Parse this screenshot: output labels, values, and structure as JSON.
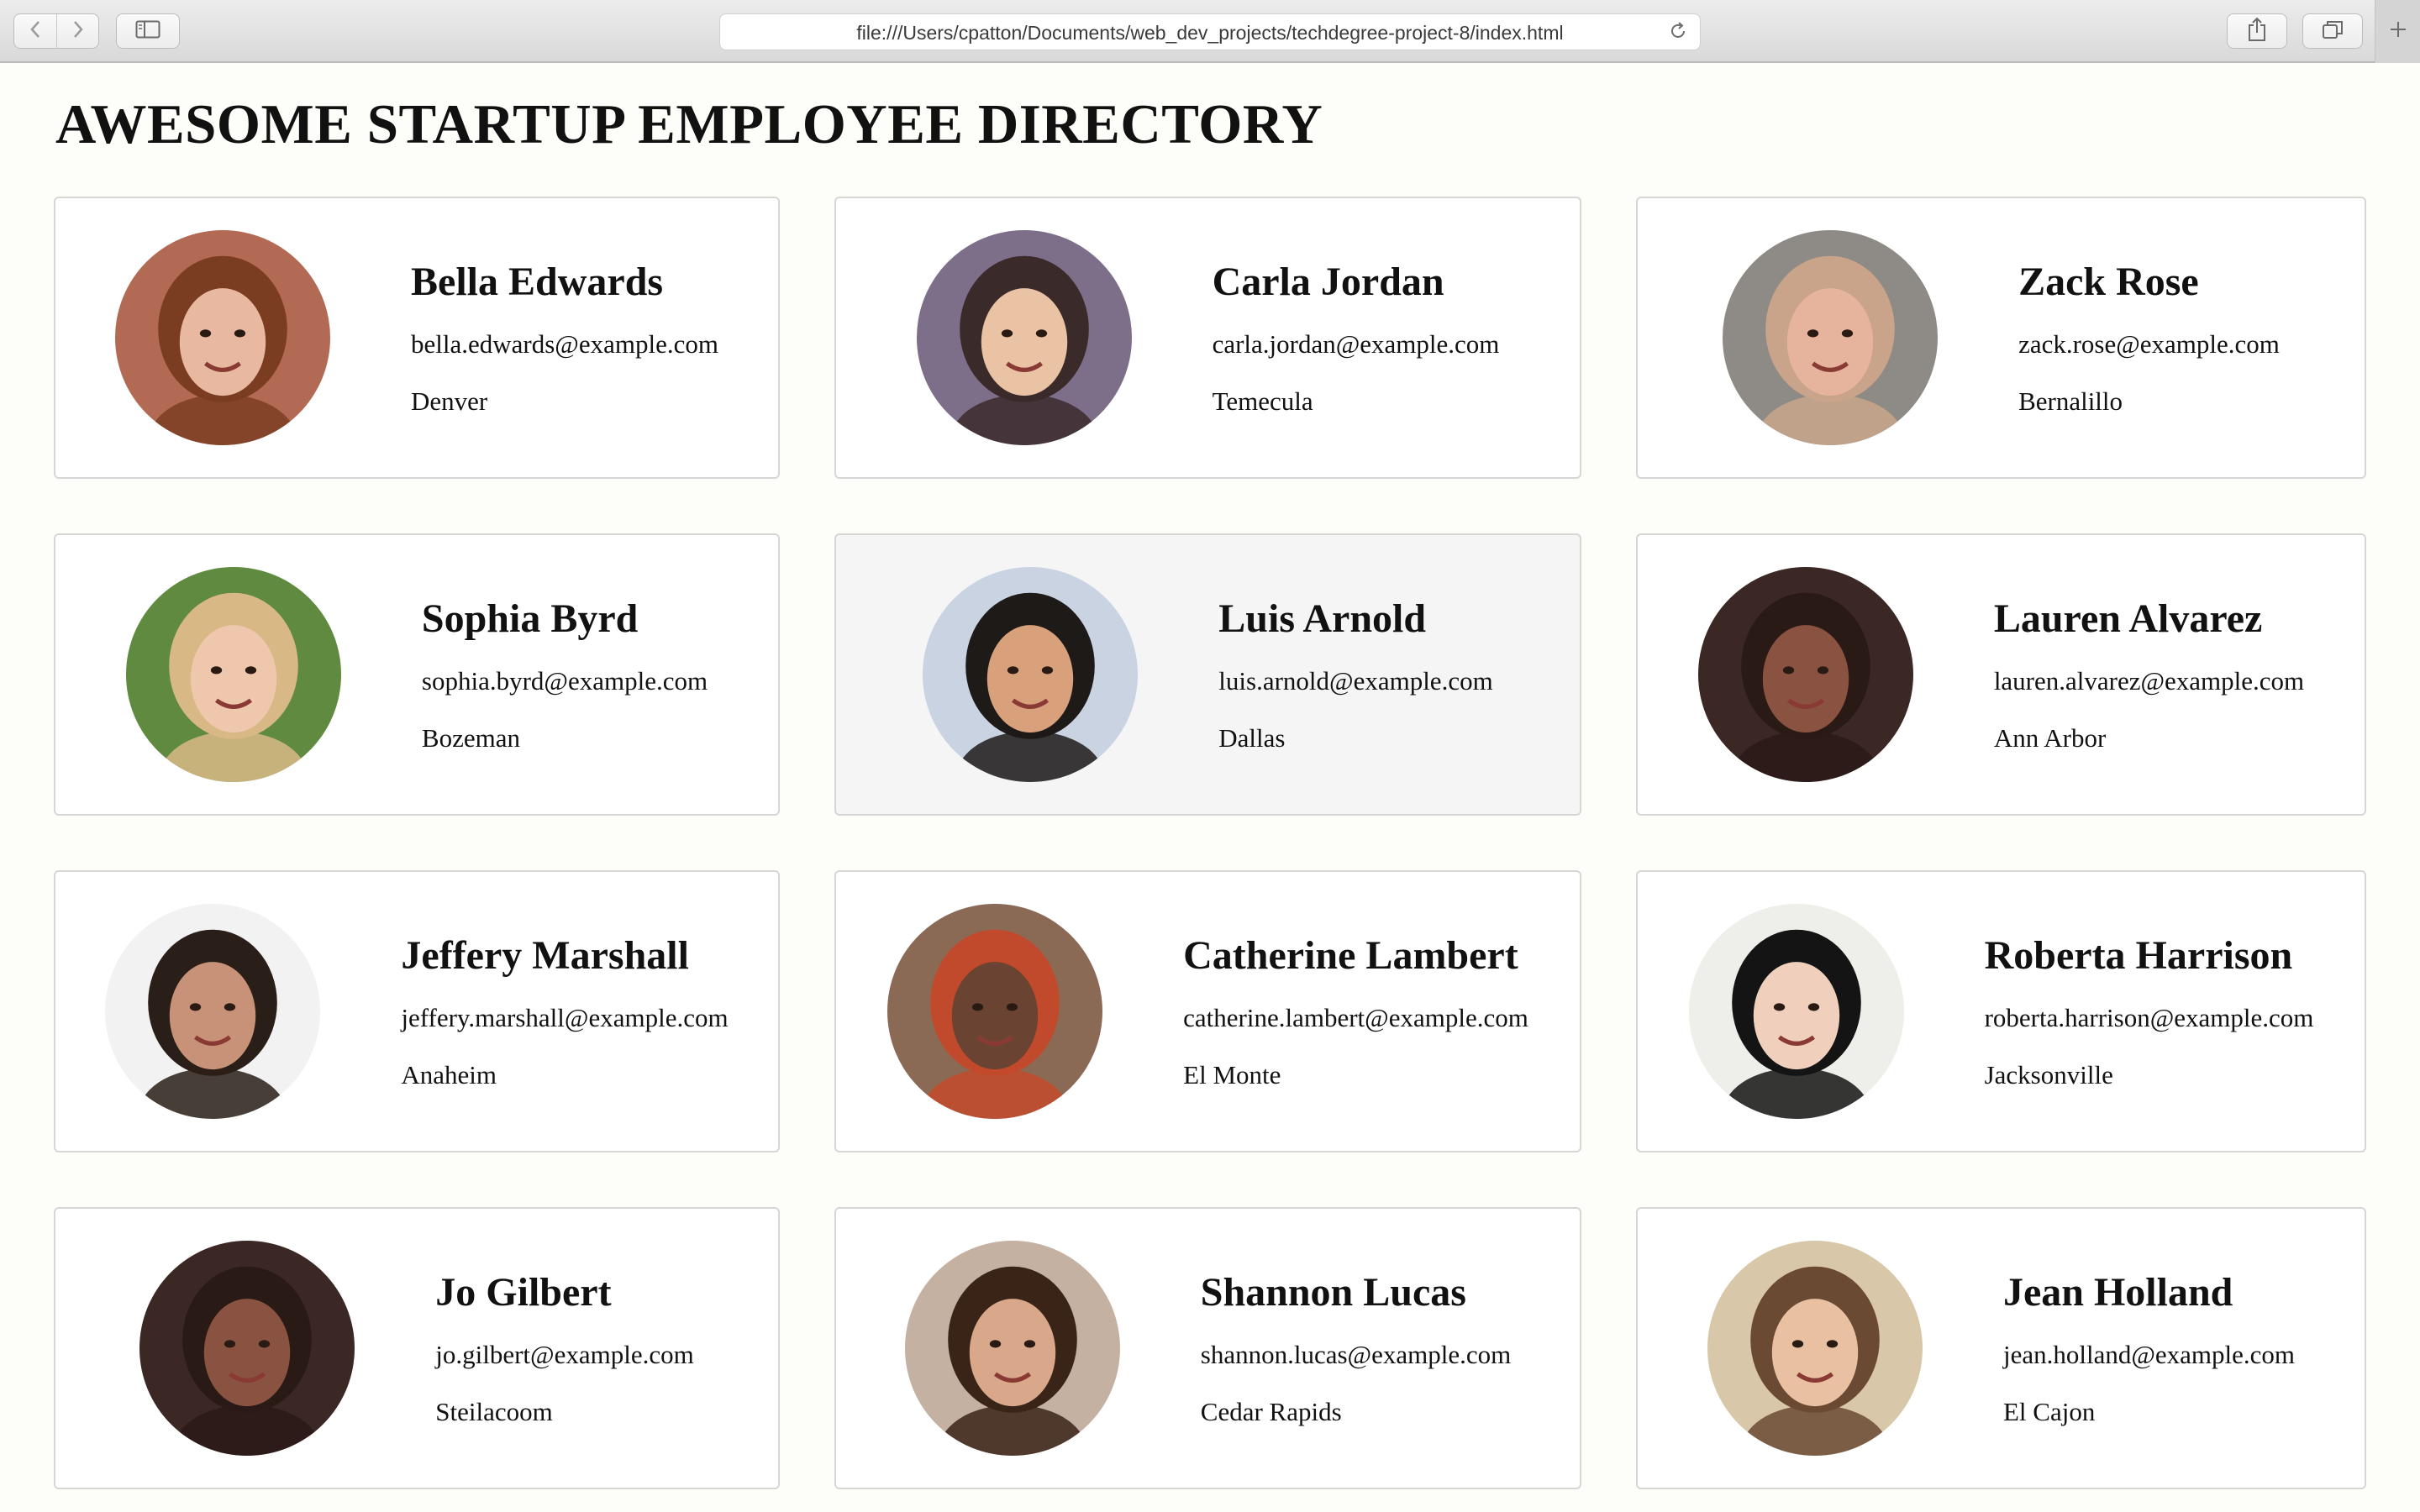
{
  "browser": {
    "url": "file:///Users/cpatton/Documents/web_dev_projects/techdegree-project-8/index.html",
    "icons": {
      "back": "chevron-left-icon",
      "forward": "chevron-right-icon",
      "sidebar": "sidebar-icon",
      "reload": "reload-icon",
      "share": "share-icon",
      "tabs": "tabs-overview-icon",
      "new_tab": "plus-icon"
    }
  },
  "page": {
    "title": "AWESOME STARTUP EMPLOYEE DIRECTORY"
  },
  "employees": [
    {
      "name": "Bella Edwards",
      "email": "bella.edwards@example.com",
      "city": "Denver",
      "skin": "#e8b9a0",
      "hair": "#7a3d22",
      "bg": "#b36a55"
    },
    {
      "name": "Carla Jordan",
      "email": "carla.jordan@example.com",
      "city": "Temecula",
      "skin": "#e9c3a4",
      "hair": "#3b2a2a",
      "bg": "#7d6f8a"
    },
    {
      "name": "Zack Rose",
      "email": "zack.rose@example.com",
      "city": "Bernalillo",
      "skin": "#e6b49c",
      "hair": "#c9a48a",
      "bg": "#8e8a86"
    },
    {
      "name": "Sophia Byrd",
      "email": "sophia.byrd@example.com",
      "city": "Bozeman",
      "skin": "#eec7ad",
      "hair": "#d8b985",
      "bg": "#5f8a3f"
    },
    {
      "name": "Luis Arnold",
      "email": "luis.arnold@example.com",
      "city": "Dallas",
      "skin": "#d9a07c",
      "hair": "#1e1a18",
      "bg": "#c9d3e2"
    },
    {
      "name": "Lauren Alvarez",
      "email": "lauren.alvarez@example.com",
      "city": "Ann Arbor",
      "skin": "#8a5240",
      "hair": "#2a1a16",
      "bg": "#3b2723"
    },
    {
      "name": "Jeffery Marshall",
      "email": "jeffery.marshall@example.com",
      "city": "Anaheim",
      "skin": "#c79277",
      "hair": "#2a1e18",
      "bg": "#f2f2f2"
    },
    {
      "name": "Catherine Lambert",
      "email": "catherine.lambert@example.com",
      "city": "El Monte",
      "skin": "#6b4332",
      "hair": "#c24a2c",
      "bg": "#8a6a55"
    },
    {
      "name": "Roberta Harrison",
      "email": "roberta.harrison@example.com",
      "city": "Jacksonville",
      "skin": "#f0d0bd",
      "hair": "#141414",
      "bg": "#eeeeea"
    },
    {
      "name": "Jo Gilbert",
      "email": "jo.gilbert@example.com",
      "city": "Steilacoom",
      "skin": "#8a5240",
      "hair": "#2a1a16",
      "bg": "#3b2723"
    },
    {
      "name": "Shannon Lucas",
      "email": "shannon.lucas@example.com",
      "city": "Cedar Rapids",
      "skin": "#d9a88a",
      "hair": "#3a2418",
      "bg": "#c5b1a2"
    },
    {
      "name": "Jean Holland",
      "email": "jean.holland@example.com",
      "city": "El Cajon",
      "skin": "#e9c0a2",
      "hair": "#6a4a32",
      "bg": "#d8c7a8"
    }
  ],
  "hovered_card_index": 4
}
